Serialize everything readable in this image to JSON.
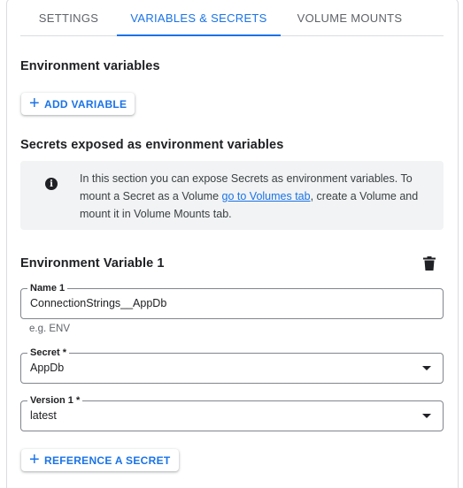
{
  "tabs": [
    {
      "label": "SETTINGS",
      "active": false
    },
    {
      "label": "VARIABLES & SECRETS",
      "active": true
    },
    {
      "label": "VOLUME MOUNTS",
      "active": false
    }
  ],
  "env_vars": {
    "title": "Environment variables",
    "add_button": "ADD VARIABLE"
  },
  "secrets": {
    "title": "Secrets exposed as environment variables",
    "info": {
      "text_before_link": "In this section you can expose Secrets as environment variables. To mount a Secret as a Volume ",
      "link_text": "go to Volumes tab",
      "text_after_link": ", create a Volume and mount it in Volume Mounts tab."
    }
  },
  "env_var_item": {
    "title": "Environment Variable 1",
    "delete_icon": "trash-icon",
    "name_field": {
      "label": "Name 1",
      "value": "ConnectionStrings__AppDb",
      "hint": "e.g. ENV"
    },
    "secret_field": {
      "label": "Secret *",
      "value": "AppDb"
    },
    "version_field": {
      "label": "Version 1 *",
      "value": "latest"
    },
    "reference_button": "REFERENCE A SECRET"
  },
  "colors": {
    "accent": "#1a73e8",
    "info_bg": "#f1f3f4",
    "border": "#80868b"
  }
}
